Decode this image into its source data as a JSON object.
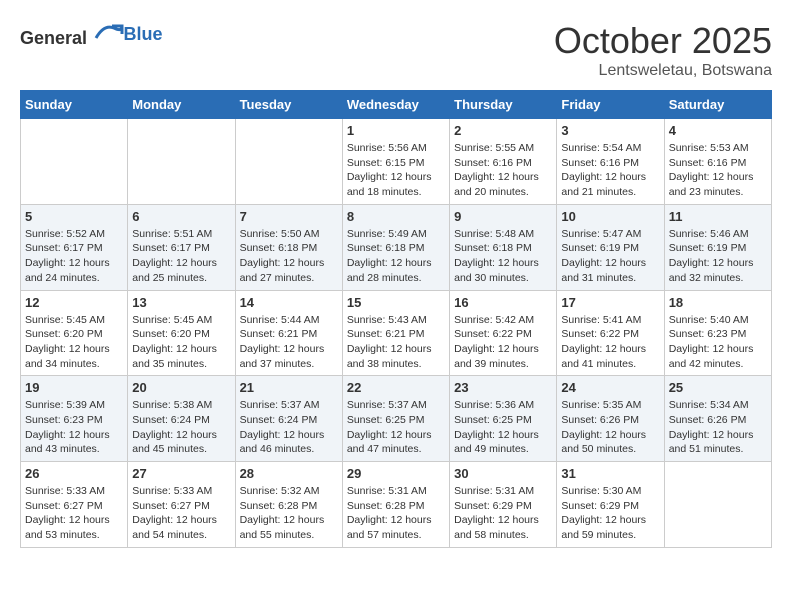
{
  "header": {
    "logo_general": "General",
    "logo_blue": "Blue",
    "month": "October 2025",
    "location": "Lentsweletau, Botswana"
  },
  "days_of_week": [
    "Sunday",
    "Monday",
    "Tuesday",
    "Wednesday",
    "Thursday",
    "Friday",
    "Saturday"
  ],
  "weeks": [
    [
      {
        "day": "",
        "sunrise": "",
        "sunset": "",
        "daylight": ""
      },
      {
        "day": "",
        "sunrise": "",
        "sunset": "",
        "daylight": ""
      },
      {
        "day": "",
        "sunrise": "",
        "sunset": "",
        "daylight": ""
      },
      {
        "day": "1",
        "sunrise": "Sunrise: 5:56 AM",
        "sunset": "Sunset: 6:15 PM",
        "daylight": "Daylight: 12 hours and 18 minutes."
      },
      {
        "day": "2",
        "sunrise": "Sunrise: 5:55 AM",
        "sunset": "Sunset: 6:16 PM",
        "daylight": "Daylight: 12 hours and 20 minutes."
      },
      {
        "day": "3",
        "sunrise": "Sunrise: 5:54 AM",
        "sunset": "Sunset: 6:16 PM",
        "daylight": "Daylight: 12 hours and 21 minutes."
      },
      {
        "day": "4",
        "sunrise": "Sunrise: 5:53 AM",
        "sunset": "Sunset: 6:16 PM",
        "daylight": "Daylight: 12 hours and 23 minutes."
      }
    ],
    [
      {
        "day": "5",
        "sunrise": "Sunrise: 5:52 AM",
        "sunset": "Sunset: 6:17 PM",
        "daylight": "Daylight: 12 hours and 24 minutes."
      },
      {
        "day": "6",
        "sunrise": "Sunrise: 5:51 AM",
        "sunset": "Sunset: 6:17 PM",
        "daylight": "Daylight: 12 hours and 25 minutes."
      },
      {
        "day": "7",
        "sunrise": "Sunrise: 5:50 AM",
        "sunset": "Sunset: 6:18 PM",
        "daylight": "Daylight: 12 hours and 27 minutes."
      },
      {
        "day": "8",
        "sunrise": "Sunrise: 5:49 AM",
        "sunset": "Sunset: 6:18 PM",
        "daylight": "Daylight: 12 hours and 28 minutes."
      },
      {
        "day": "9",
        "sunrise": "Sunrise: 5:48 AM",
        "sunset": "Sunset: 6:18 PM",
        "daylight": "Daylight: 12 hours and 30 minutes."
      },
      {
        "day": "10",
        "sunrise": "Sunrise: 5:47 AM",
        "sunset": "Sunset: 6:19 PM",
        "daylight": "Daylight: 12 hours and 31 minutes."
      },
      {
        "day": "11",
        "sunrise": "Sunrise: 5:46 AM",
        "sunset": "Sunset: 6:19 PM",
        "daylight": "Daylight: 12 hours and 32 minutes."
      }
    ],
    [
      {
        "day": "12",
        "sunrise": "Sunrise: 5:45 AM",
        "sunset": "Sunset: 6:20 PM",
        "daylight": "Daylight: 12 hours and 34 minutes."
      },
      {
        "day": "13",
        "sunrise": "Sunrise: 5:45 AM",
        "sunset": "Sunset: 6:20 PM",
        "daylight": "Daylight: 12 hours and 35 minutes."
      },
      {
        "day": "14",
        "sunrise": "Sunrise: 5:44 AM",
        "sunset": "Sunset: 6:21 PM",
        "daylight": "Daylight: 12 hours and 37 minutes."
      },
      {
        "day": "15",
        "sunrise": "Sunrise: 5:43 AM",
        "sunset": "Sunset: 6:21 PM",
        "daylight": "Daylight: 12 hours and 38 minutes."
      },
      {
        "day": "16",
        "sunrise": "Sunrise: 5:42 AM",
        "sunset": "Sunset: 6:22 PM",
        "daylight": "Daylight: 12 hours and 39 minutes."
      },
      {
        "day": "17",
        "sunrise": "Sunrise: 5:41 AM",
        "sunset": "Sunset: 6:22 PM",
        "daylight": "Daylight: 12 hours and 41 minutes."
      },
      {
        "day": "18",
        "sunrise": "Sunrise: 5:40 AM",
        "sunset": "Sunset: 6:23 PM",
        "daylight": "Daylight: 12 hours and 42 minutes."
      }
    ],
    [
      {
        "day": "19",
        "sunrise": "Sunrise: 5:39 AM",
        "sunset": "Sunset: 6:23 PM",
        "daylight": "Daylight: 12 hours and 43 minutes."
      },
      {
        "day": "20",
        "sunrise": "Sunrise: 5:38 AM",
        "sunset": "Sunset: 6:24 PM",
        "daylight": "Daylight: 12 hours and 45 minutes."
      },
      {
        "day": "21",
        "sunrise": "Sunrise: 5:37 AM",
        "sunset": "Sunset: 6:24 PM",
        "daylight": "Daylight: 12 hours and 46 minutes."
      },
      {
        "day": "22",
        "sunrise": "Sunrise: 5:37 AM",
        "sunset": "Sunset: 6:25 PM",
        "daylight": "Daylight: 12 hours and 47 minutes."
      },
      {
        "day": "23",
        "sunrise": "Sunrise: 5:36 AM",
        "sunset": "Sunset: 6:25 PM",
        "daylight": "Daylight: 12 hours and 49 minutes."
      },
      {
        "day": "24",
        "sunrise": "Sunrise: 5:35 AM",
        "sunset": "Sunset: 6:26 PM",
        "daylight": "Daylight: 12 hours and 50 minutes."
      },
      {
        "day": "25",
        "sunrise": "Sunrise: 5:34 AM",
        "sunset": "Sunset: 6:26 PM",
        "daylight": "Daylight: 12 hours and 51 minutes."
      }
    ],
    [
      {
        "day": "26",
        "sunrise": "Sunrise: 5:33 AM",
        "sunset": "Sunset: 6:27 PM",
        "daylight": "Daylight: 12 hours and 53 minutes."
      },
      {
        "day": "27",
        "sunrise": "Sunrise: 5:33 AM",
        "sunset": "Sunset: 6:27 PM",
        "daylight": "Daylight: 12 hours and 54 minutes."
      },
      {
        "day": "28",
        "sunrise": "Sunrise: 5:32 AM",
        "sunset": "Sunset: 6:28 PM",
        "daylight": "Daylight: 12 hours and 55 minutes."
      },
      {
        "day": "29",
        "sunrise": "Sunrise: 5:31 AM",
        "sunset": "Sunset: 6:28 PM",
        "daylight": "Daylight: 12 hours and 57 minutes."
      },
      {
        "day": "30",
        "sunrise": "Sunrise: 5:31 AM",
        "sunset": "Sunset: 6:29 PM",
        "daylight": "Daylight: 12 hours and 58 minutes."
      },
      {
        "day": "31",
        "sunrise": "Sunrise: 5:30 AM",
        "sunset": "Sunset: 6:29 PM",
        "daylight": "Daylight: 12 hours and 59 minutes."
      },
      {
        "day": "",
        "sunrise": "",
        "sunset": "",
        "daylight": ""
      }
    ]
  ]
}
